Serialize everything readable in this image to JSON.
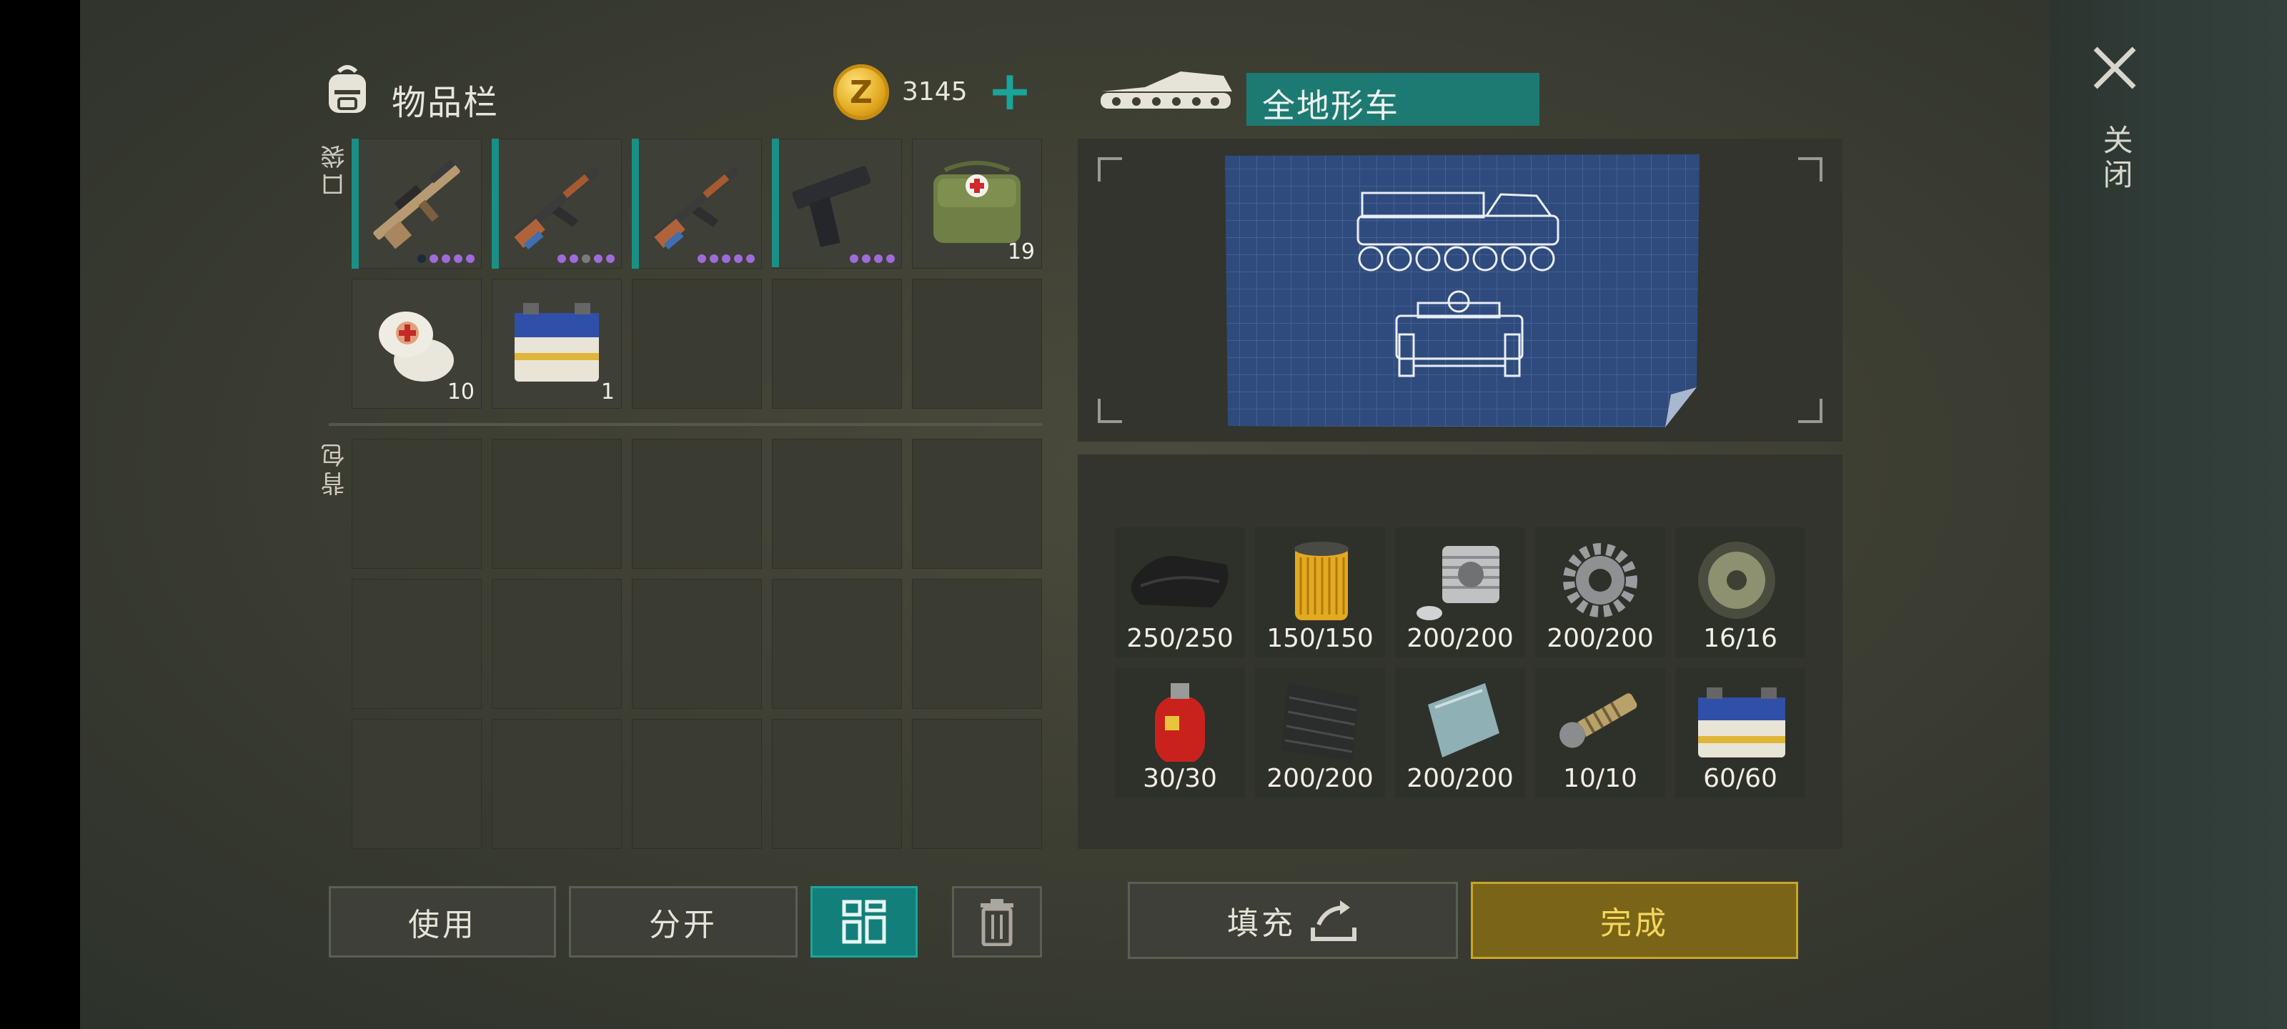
{
  "inventory": {
    "title": "物品栏",
    "coins": "3145",
    "coin_symbol": "Z",
    "plus": "+",
    "pocket_label": "口袋",
    "backpack_label": "背包",
    "pocket_items": [
      {
        "icon": "scar-rifle-icon",
        "rarity_dots": 5
      },
      {
        "icon": "ak-rifle-icon",
        "rarity_dots": 5
      },
      {
        "icon": "ak-rifle-icon",
        "rarity_dots": 5
      },
      {
        "icon": "pistol-icon",
        "rarity_dots": 4
      },
      {
        "icon": "medkit-bag-icon",
        "qty": "19"
      },
      {
        "icon": "bandage-icon",
        "qty": "10"
      },
      {
        "icon": "car-battery-icon",
        "qty": "1"
      }
    ]
  },
  "actions": {
    "use": "使用",
    "split": "分开",
    "sort_icon": "grid-sort-icon",
    "trash_icon": "trash-icon"
  },
  "vehicle": {
    "icon": "tank-vehicle-icon",
    "name": "全地形车",
    "blueprint": "all-terrain-vehicle-blueprint"
  },
  "resources": [
    {
      "icon": "rubber-sheet-icon",
      "qty": "250/250"
    },
    {
      "icon": "air-filter-icon",
      "qty": "150/150"
    },
    {
      "icon": "engine-cylinder-icon",
      "qty": "200/200"
    },
    {
      "icon": "gear-icon",
      "qty": "200/200"
    },
    {
      "icon": "wheel-icon",
      "qty": "16/16"
    },
    {
      "icon": "gas-cylinder-icon",
      "qty": "30/30"
    },
    {
      "icon": "carbon-fabric-icon",
      "qty": "200/200"
    },
    {
      "icon": "metal-plate-icon",
      "qty": "200/200"
    },
    {
      "icon": "spring-part-icon",
      "qty": "10/10"
    },
    {
      "icon": "car-battery-icon",
      "qty": "60/60"
    }
  ],
  "bottom": {
    "fill": "填充",
    "done": "完成"
  },
  "close": {
    "label": "关闭",
    "icon": "close-icon"
  },
  "colors": {
    "accent_teal": "#127f7a",
    "gold": "#c8a52b",
    "rarity_purple": "#9f6bd8"
  }
}
